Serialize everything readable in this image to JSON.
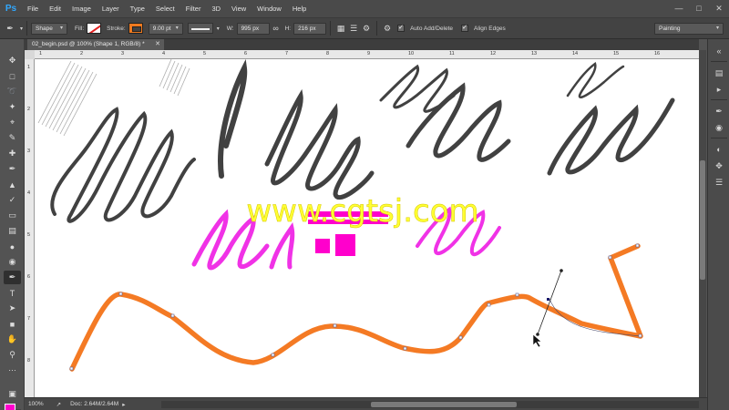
{
  "app": {
    "logo_text": "Ps"
  },
  "menu": [
    "File",
    "Edit",
    "Image",
    "Layer",
    "Type",
    "Select",
    "Filter",
    "3D",
    "View",
    "Window",
    "Help"
  ],
  "options": {
    "mode": "Shape",
    "fill_label": "Fill:",
    "stroke_label": "Stroke:",
    "stroke_width": "9.00 pt",
    "w_label": "W:",
    "w_value": "995 px",
    "h_label": "H:",
    "h_value": "216 px",
    "auto_add_delete": "Auto Add/Delete",
    "align_edges": "Align Edges",
    "workspace": "Painting",
    "stroke_color": "#f07a1f"
  },
  "document": {
    "tab_title": "02_begin.psd @ 100% (Shape 1, RGB/8) *"
  },
  "ruler_top": [
    "1",
    "2",
    "3",
    "4",
    "5",
    "6",
    "7",
    "8",
    "9",
    "10",
    "11",
    "12",
    "13",
    "14",
    "15",
    "16"
  ],
  "ruler_left": [
    "1",
    "2",
    "3",
    "4",
    "5",
    "6",
    "7",
    "8"
  ],
  "status": {
    "zoom": "100%",
    "doc_size": "Doc: 2.64M/2.64M"
  },
  "watermark": "www.cgtsj.com",
  "colors": {
    "foreground": "#ff00cc",
    "background": "#ffffff",
    "stroke_path": "#f47a24",
    "magenta_strokes": "#f032e6",
    "gray_strokes": "#414141",
    "watermark": "#ffff33"
  }
}
